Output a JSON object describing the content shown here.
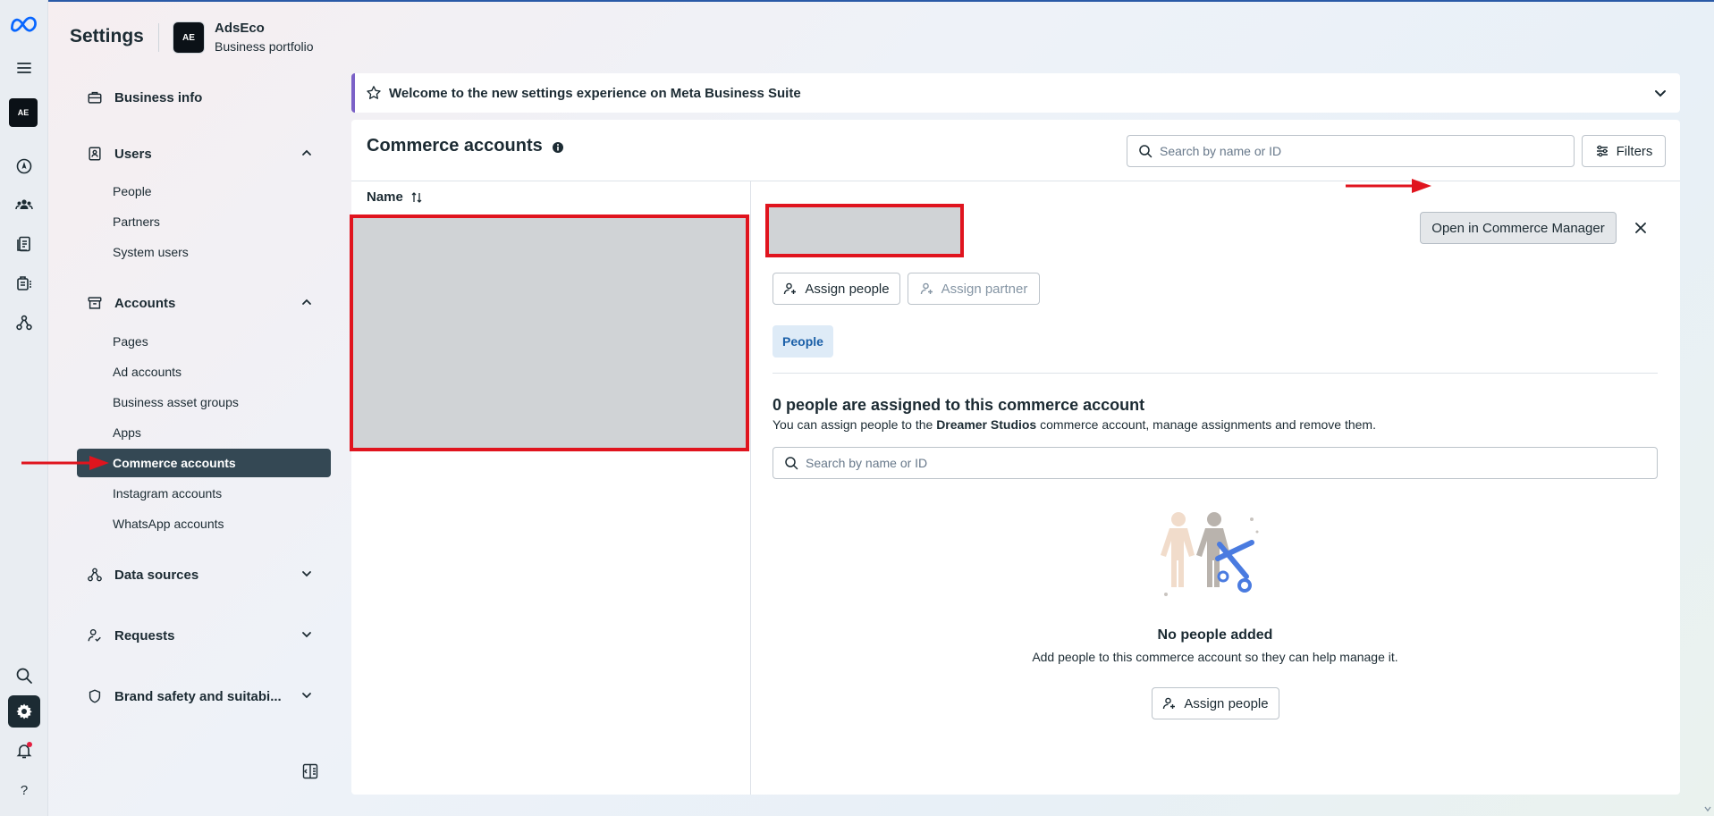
{
  "app": {
    "title": "Settings",
    "portfolio_name": "AdsEco",
    "portfolio_sub": "Business portfolio",
    "logo_text": "AE"
  },
  "rail": {
    "icons": [
      "meta-logo-icon",
      "menu-icon",
      "portfolio-avatar",
      "compass-icon",
      "people-icon",
      "pages-icon",
      "commerce-icon",
      "network-icon",
      "search-icon",
      "gear-icon",
      "bell-icon",
      "help-icon"
    ]
  },
  "nav": {
    "business_info": "Business info",
    "users": {
      "label": "Users",
      "items": [
        "People",
        "Partners",
        "System users"
      ]
    },
    "accounts": {
      "label": "Accounts",
      "items": [
        "Pages",
        "Ad accounts",
        "Business asset groups",
        "Apps",
        "Commerce accounts",
        "Instagram accounts",
        "WhatsApp accounts"
      ],
      "active": "Commerce accounts"
    },
    "data_sources": "Data sources",
    "requests": "Requests",
    "brand_safety": "Brand safety and suitabi..."
  },
  "banner": {
    "text": "Welcome to the new settings experience on Meta Business Suite"
  },
  "main": {
    "title": "Commerce accounts",
    "search_placeholder": "Search by name or ID",
    "filters_label": "Filters",
    "name_col": "Name"
  },
  "detail": {
    "open_button": "Open in Commerce Manager",
    "assign_people": "Assign people",
    "assign_partner": "Assign partner",
    "tab_people": "People",
    "assigned_title": "0 people are assigned to this commerce account",
    "assigned_sub_pre": "You can assign people to the ",
    "assigned_sub_bold": "Dreamer Studios",
    "assigned_sub_post": " commerce account, manage assignments and remove them.",
    "people_search_placeholder": "Search by name or ID",
    "empty_title": "No people added",
    "empty_sub": "Add people to this commerce account so they can help manage it.",
    "empty_button": "Assign people"
  },
  "colors": {
    "annotation_red": "#e0141e",
    "active_nav": "#344854",
    "tab_blue": "#1a5fa8",
    "banner_accent": "#7b61c7"
  }
}
